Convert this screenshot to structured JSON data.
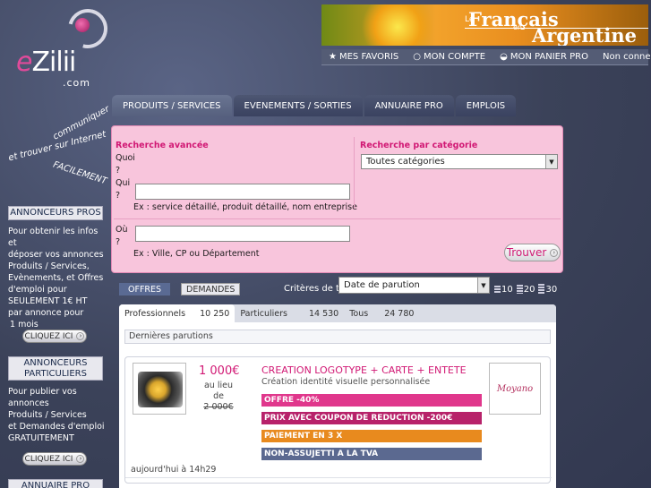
{
  "logo": {
    "text_first": "e",
    "text_rest": "Zilii",
    "domain": ".com"
  },
  "slogan": {
    "line1": "communiquer",
    "line2": "et trouver sur Internet",
    "line3": "FACILEMENT"
  },
  "banner": {
    "line1": "Français",
    "prefix": "Le",
    "en": "en",
    "line2": "Argentine"
  },
  "account_bar": {
    "favorites": "MES FAVORIS",
    "account": "MON COMPTE",
    "cart": "MON PANIER PRO",
    "status": "Non connecté"
  },
  "sidebar": {
    "pros_title": "ANNONCEURS PROS",
    "pros_text": [
      "Pour obtenir les infos et",
      "déposer vos annonces",
      "Produits / Services,",
      "Evènements, et Offres",
      "d'emploi pour",
      "SEULEMENT 1€ HT",
      "par annonce pour",
      "1 mois"
    ],
    "click_label": "CLIQUEZ ICI",
    "part_title_1": "ANNONCEURS",
    "part_title_2": "PARTICULIERS",
    "part_text": [
      "Pour publier vos",
      "annonces",
      "Produits / Services",
      "et Demandes d'emploi",
      "GRATUITEMENT"
    ],
    "annuaire_title": "ANNUAIRE PRO"
  },
  "main_tabs": [
    {
      "label": "PRODUITS / SERVICES"
    },
    {
      "label": "EVENEMENTS / SORTIES"
    },
    {
      "label": "ANNUAIRE PRO"
    },
    {
      "label": "EMPLOIS"
    }
  ],
  "search": {
    "advanced_title": "Recherche avancée",
    "what_label": "Quoi",
    "q1": "?",
    "who_label": "Qui",
    "q2": "?",
    "who_hint": "Ex : service détaillé, produit détaillé, nom entreprise",
    "where_label": "Où",
    "q3": "?",
    "where_hint": "Ex : Ville, CP ou Département",
    "category_title": "Recherche par catégorie",
    "category_selected": "Toutes catégories",
    "find_label": "Trouver",
    "who_value": "",
    "where_value": ""
  },
  "toolbar": {
    "offers": "OFFRES",
    "demands": "DEMANDES",
    "criteria_label": "Critères de tri",
    "sort_selected": "Date de parution",
    "sizes": [
      "10",
      "20",
      "30"
    ]
  },
  "results": {
    "tabs": [
      {
        "label": "Professionnels",
        "count": "10 250"
      },
      {
        "label": "Particuliers",
        "count": "14 530"
      },
      {
        "label": "Tous",
        "count": "24 780"
      }
    ],
    "section_title": "Dernières parutions",
    "ad": {
      "price": "1 000€",
      "instead_1": "au lieu",
      "instead_2": "de",
      "old_price": "2 000€",
      "title": "CREATION LOGOTYPE + CARTE + ENTETE",
      "subtitle": "Création identité visuelle personnalisée",
      "tags": [
        {
          "label": "OFFRE -40%",
          "color": "#e0378c"
        },
        {
          "label": "PRIX AVEC COUPON DE REDUCTION -200€",
          "color": "#b7226a"
        },
        {
          "label": "PAIEMENT EN 3 X",
          "color": "#e88a1e"
        },
        {
          "label": "NON-ASSUJETTI A LA TVA",
          "color": "#5b6990"
        }
      ],
      "brand_logo": "Moyano",
      "date": "aujourd'hui à 14h29"
    }
  },
  "colors": {
    "accent": "#d11874",
    "panel": "#f8c5dc",
    "background": "#3b4259"
  }
}
